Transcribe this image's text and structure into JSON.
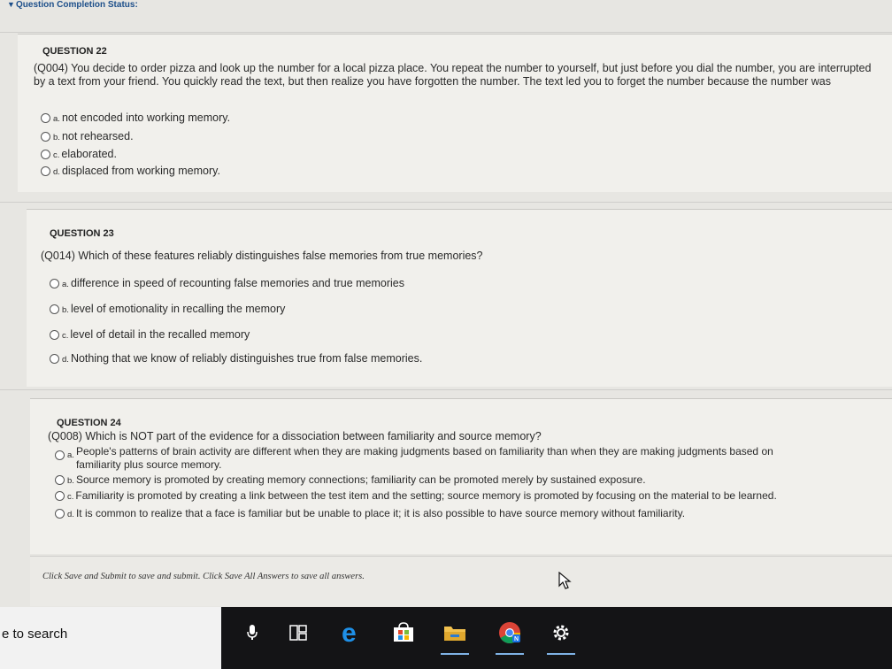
{
  "status": {
    "label": "Question Completion Status:"
  },
  "questions": [
    {
      "title": "QUESTION 22",
      "text": "(Q004) You decide to order pizza and look up the number for a local pizza place. You repeat the number to yourself, but just before you dial the number, you are interrupted by a text from your friend. You quickly read the text, but then realize you have forgotten the number. The text led you to forget the number because the number was",
      "options": [
        {
          "letter": "a.",
          "text": "not encoded into working memory."
        },
        {
          "letter": "b.",
          "text": "not rehearsed."
        },
        {
          "letter": "c.",
          "text": "elaborated."
        },
        {
          "letter": "d.",
          "text": "displaced from working memory."
        }
      ]
    },
    {
      "title": "QUESTION 23",
      "text": "(Q014) Which of these features reliably distinguishes false memories from true memories?",
      "options": [
        {
          "letter": "a.",
          "text": "difference in speed of recounting false memories and true memories"
        },
        {
          "letter": "b.",
          "text": "level of emotionality in recalling the memory"
        },
        {
          "letter": "c.",
          "text": "level of detail in the recalled memory"
        },
        {
          "letter": "d.",
          "text": "Nothing that we know of reliably distinguishes true from false memories."
        }
      ]
    },
    {
      "title": "QUESTION 24",
      "text": "(Q008) Which is NOT part of the evidence for a dissociation between familiarity and source memory?",
      "options": [
        {
          "letter": "a.",
          "text": "People's patterns of brain activity are different when they are making judgments based on familiarity than when they are making judgments based on",
          "text2": "familiarity plus source memory."
        },
        {
          "letter": "b.",
          "text": "Source memory is promoted by creating memory connections; familiarity can be promoted merely by sustained exposure."
        },
        {
          "letter": "c.",
          "text": "Familiarity is promoted by creating a link between the test item and the setting; source memory is promoted by focusing on the material to be learned."
        },
        {
          "letter": "d.",
          "text": "It is common to realize that a face is familiar but be unable to place it; it is also possible to have source memory without familiarity."
        }
      ]
    }
  ],
  "footer": {
    "text": "Click Save and Submit to save and submit. Click Save All Answers to save all answers."
  },
  "taskbar": {
    "search_text": "e to search",
    "icons": [
      "microphone-icon",
      "task-view-icon",
      "edge-browser-icon",
      "store-icon",
      "file-explorer-icon",
      "chrome-icon",
      "settings-icon"
    ]
  }
}
